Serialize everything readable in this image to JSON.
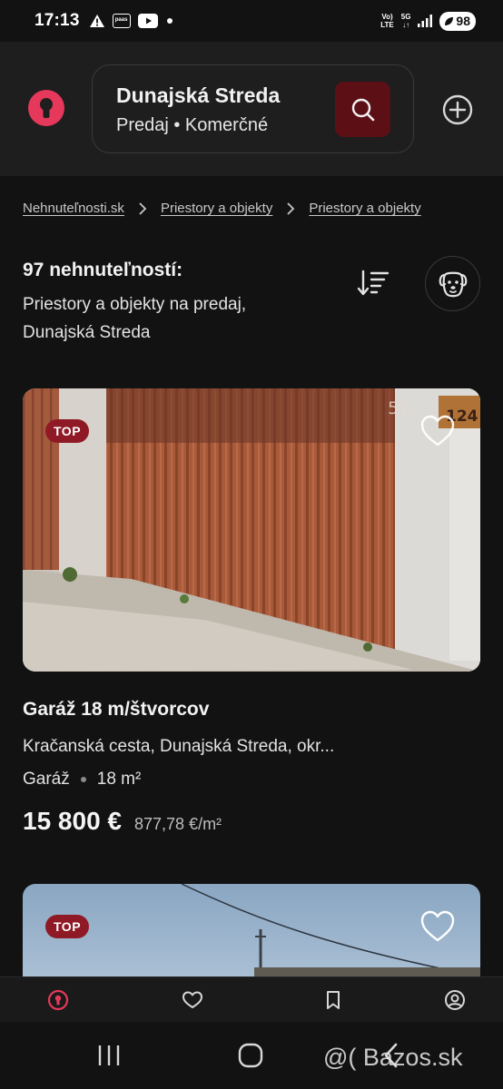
{
  "status_bar": {
    "time": "17:13",
    "net_top": "Vo)",
    "net_bottom": "LTE",
    "net_gen": "5G",
    "battery": "98",
    "icons": [
      "warning-icon",
      "paas-app-icon",
      "youtube-icon",
      "dot-icon",
      "signal-icon",
      "battery-icon"
    ]
  },
  "header": {
    "location": "Dunajská Streda",
    "filter": "Predaj • Komerčné",
    "colors": {
      "brand": "#e6385a",
      "search_button": "#5c1016"
    }
  },
  "breadcrumb": [
    {
      "label": "Nehnuteľnosti.sk"
    },
    {
      "label": "Priestory a objekty"
    },
    {
      "label": "Priestory a objekty"
    }
  ],
  "results": {
    "count": "97 nehnuteľností:",
    "description": "Priestory a objekty na predaj, Dunajská Streda"
  },
  "listings": [
    {
      "badge": "TOP",
      "title": "Garáž 18 m/štvorcov",
      "address": "Kračanská cesta, Dunajská Streda, okr...",
      "type": "Garáž",
      "area": "18 m²",
      "price": "15 800 €",
      "price_per_m2": "877,78 €/m²",
      "image_text": {
        "number": "57",
        "house_number": "124"
      }
    },
    {
      "badge": "TOP"
    }
  ],
  "bottom_nav": [
    "home-icon",
    "heart-icon",
    "bookmark-icon",
    "profile-icon"
  ],
  "watermark": "@( Bazos.sk"
}
